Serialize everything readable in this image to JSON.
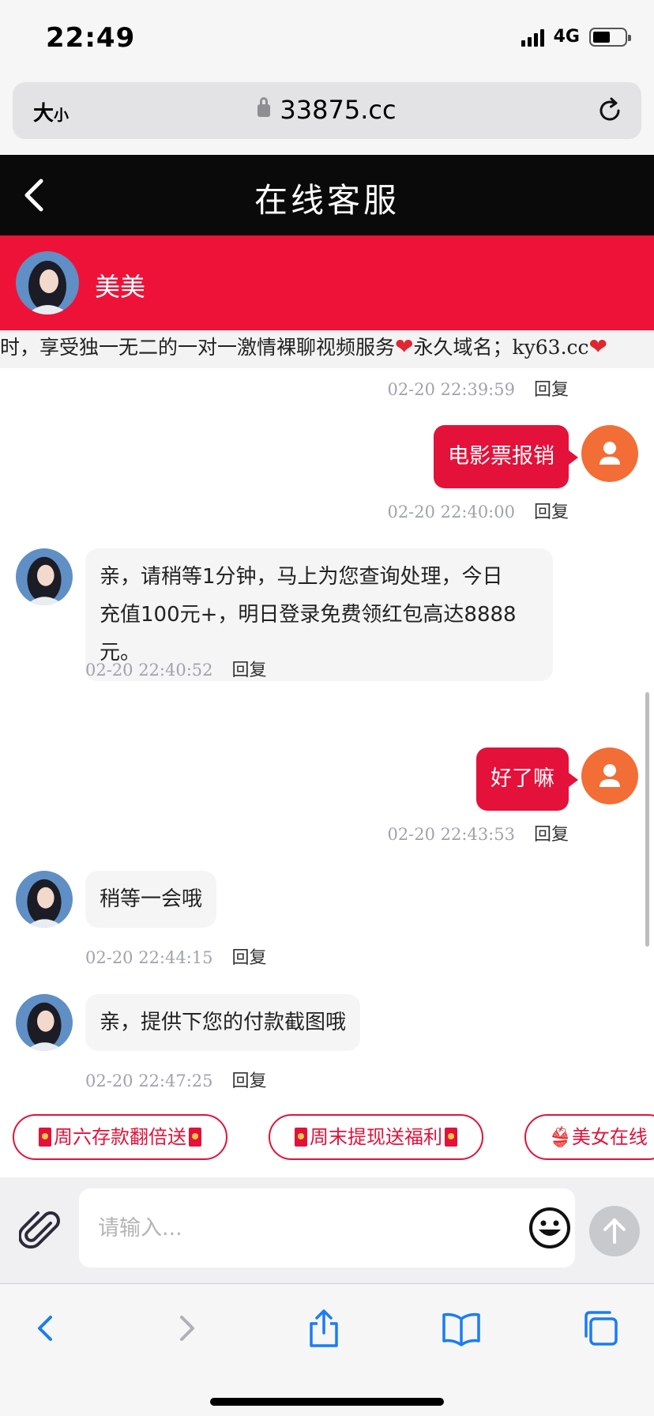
{
  "status_bar": {
    "time": "22:49",
    "network": "4G"
  },
  "browser": {
    "text_size_label": "大",
    "text_size_small": "小",
    "url": "33875.cc"
  },
  "header": {
    "title": "在线客服"
  },
  "agent": {
    "name": "美美"
  },
  "marquee": {
    "part1": "时，享受独一无二的一对一激情裸聊视频服务",
    "part2": "永久域名；ky63.cc"
  },
  "reply_label": "回复",
  "messages": [
    {
      "timestamp": "02-20 22:39:59"
    },
    {
      "text": "电影票报销",
      "timestamp": "02-20 22:40:00"
    },
    {
      "line1": "亲，请稍等1分钟，马上为您查询处理，今日",
      "line2": "充值100元+，明日登录免费领红包高达8888",
      "line3": "元。",
      "timestamp": "02-20 22:40:52"
    },
    {
      "text": "好了嘛",
      "timestamp": "02-20 22:43:53"
    },
    {
      "text": "稍等一会哦",
      "timestamp": "02-20 22:44:15"
    },
    {
      "text": "亲，提供下您的付款截图哦",
      "timestamp": "02-20 22:47:25"
    }
  ],
  "quick_replies": [
    "周六存款翻倍送",
    "周末提现送福利",
    "美女在线"
  ],
  "input": {
    "placeholder": "请输入..."
  },
  "colors": {
    "header_bg": "#0a0a0a",
    "accent_red": "#e4113a",
    "user_avatar": "#f36d36",
    "ios_blue": "#1a7cf5"
  },
  "toolbar_icons": [
    "back-icon",
    "forward-icon",
    "share-icon",
    "bookmarks-icon",
    "tabs-icon"
  ]
}
